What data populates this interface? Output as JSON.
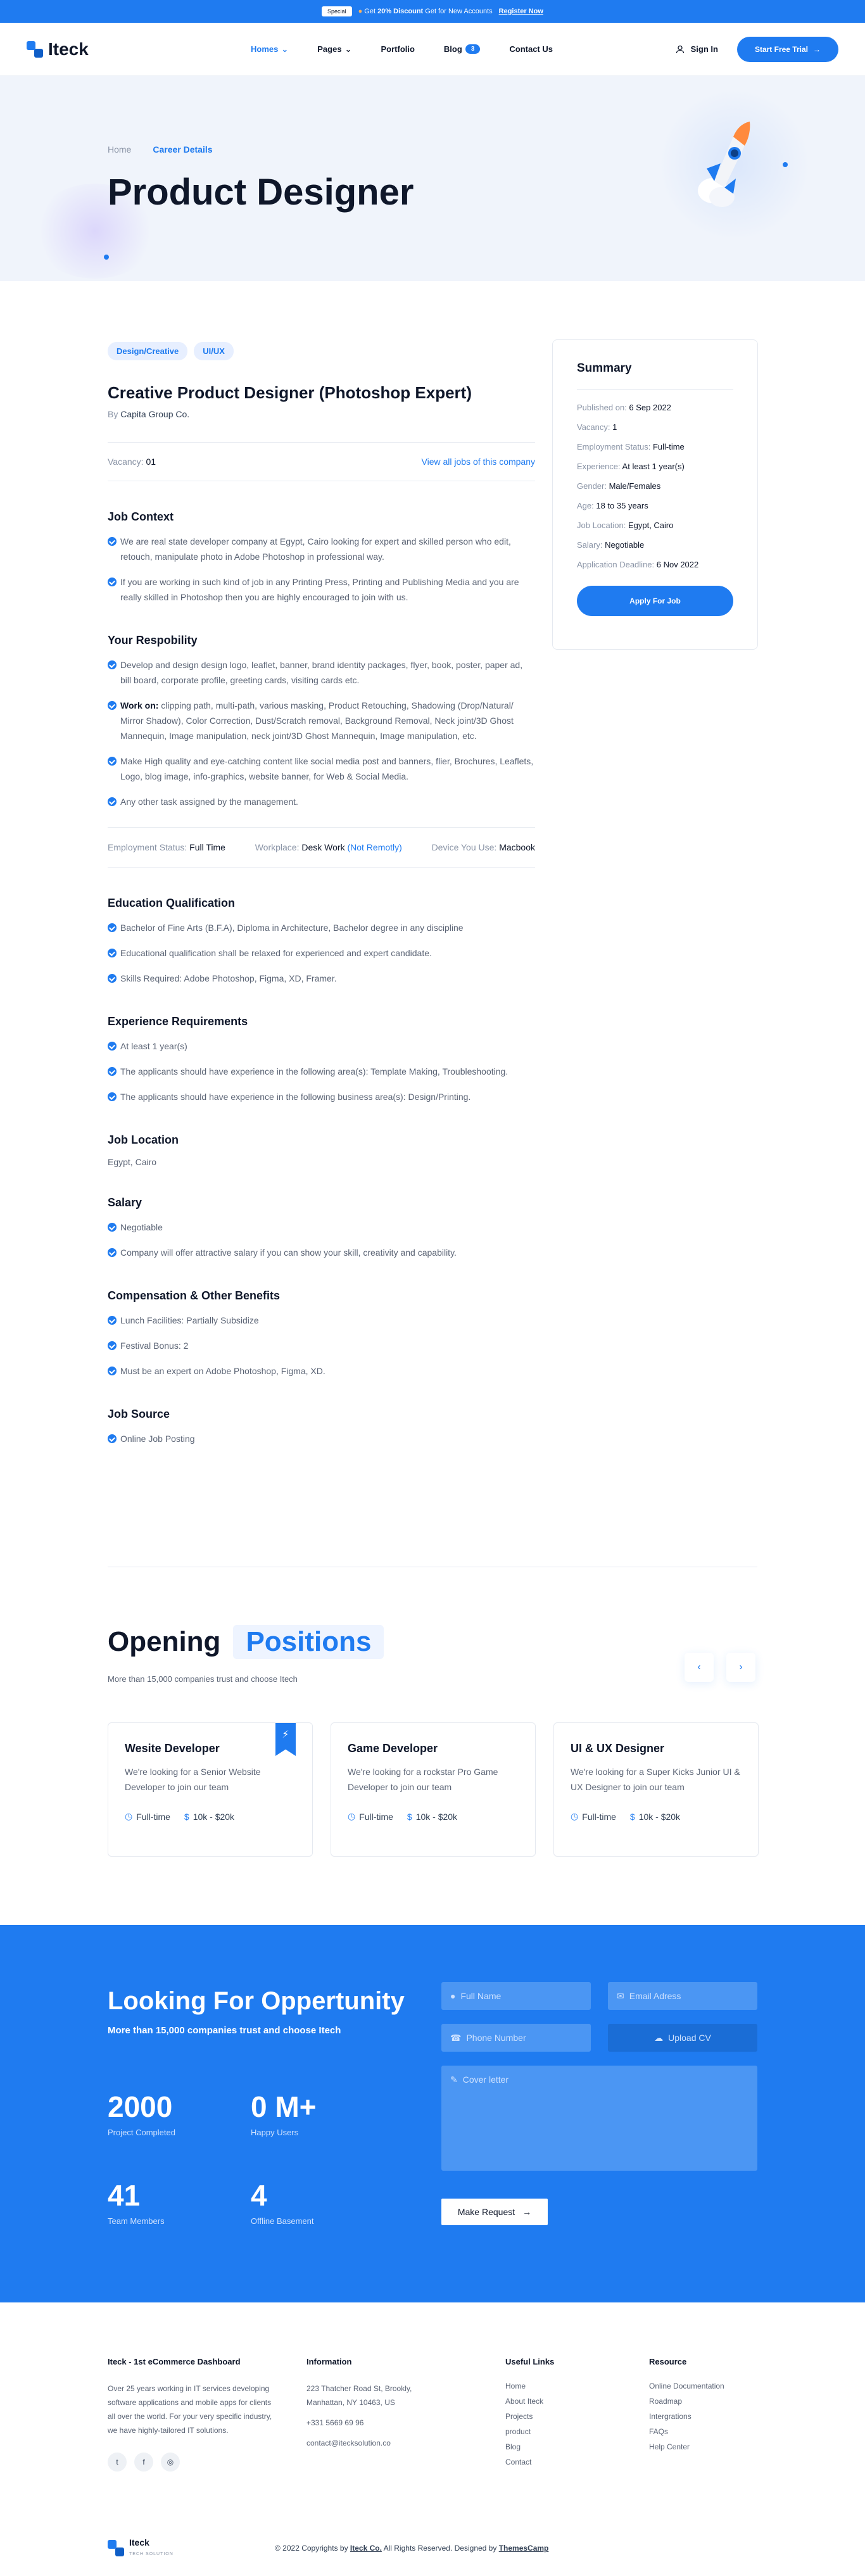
{
  "topbar": {
    "badge": "Special",
    "text_pre": "Get ",
    "discount": "20% Discount",
    "text_post": " Get for New Accounts",
    "register": "Register Now"
  },
  "header": {
    "logo": "Iteck",
    "nav": [
      {
        "label": "Homes",
        "dropdown": true,
        "active": true
      },
      {
        "label": "Pages",
        "dropdown": true,
        "active": false
      },
      {
        "label": "Portfolio",
        "dropdown": false,
        "active": false
      },
      {
        "label": "Blog",
        "dropdown": false,
        "active": false,
        "count": "3"
      },
      {
        "label": "Contact Us",
        "dropdown": false,
        "active": false
      }
    ],
    "sign_in": "Sign In",
    "cta": "Start Free Trial"
  },
  "hero": {
    "crumb_home": "Home",
    "crumb_current": "Career Details",
    "title": "Product Designer"
  },
  "job": {
    "tags": [
      "Design/Creative",
      "UI/UX"
    ],
    "title": "Creative Product Designer (Photoshop Expert)",
    "by_label": "By ",
    "company": "Capita Group Co.",
    "vacancy_label": "Vacancy: ",
    "vacancy": "01",
    "view_all": "View all jobs of this company",
    "context_title": "Job Context",
    "context": [
      "We are real state developer company at Egypt, Cairo looking for expert and skilled person who edit, retouch, manipulate photo in Adobe Photoshop in professional way.",
      "If you are working in such kind of job in any Printing Press, Printing and Publishing Media and you are really skilled in Photoshop then you are highly encouraged to join with us."
    ],
    "resp_title": "Your Respobility",
    "resp": [
      {
        "bold": "",
        "text": "Develop and design design logo, leaflet, banner, brand identity packages, flyer, book, poster, paper ad, bill board, corporate profile, greeting cards, visiting cards etc."
      },
      {
        "bold": "Work on: ",
        "text": "clipping path, multi-path, various masking, Product Retouching, Shadowing (Drop/Natural/ Mirror Shadow), Color Correction, Dust/Scratch removal, Background Removal, Neck joint/3D Ghost Mannequin, Image manipulation, neck joint/3D Ghost Mannequin, Image manipulation, etc."
      },
      {
        "bold": "",
        "text": "Make High quality and eye-catching content like social media post and banners, flier, Brochures, Leaflets, Logo, blog image, info-graphics, website banner, for Web & Social Media."
      },
      {
        "bold": "",
        "text": "Any other task assigned by the management."
      }
    ],
    "meta": {
      "employment_label": "Employment Status: ",
      "employment": "Full Time",
      "workplace_label": "Workplace: ",
      "workplace": "Desk Work",
      "workplace_note": "(Not Remotly)",
      "device_label": "Device You Use: ",
      "device": "Macbook"
    },
    "edu_title": "Education Qualification",
    "edu": [
      "Bachelor of Fine Arts (B.F.A), Diploma in Architecture, Bachelor degree in any discipline",
      "Educational qualification shall be relaxed for experienced and expert candidate.",
      "Skills Required: Adobe Photoshop, Figma, XD, Framer."
    ],
    "exp_title": "Experience Requirements",
    "exp": [
      "At least 1 year(s)",
      "The applicants should have experience in the following area(s): Template Making, Troubleshooting.",
      "The applicants should have experience in the following business area(s): Design/Printing."
    ],
    "loc_title": "Job Location",
    "location": "Egypt, Cairo",
    "salary_title": "Salary",
    "salary": [
      "Negotiable",
      "Company will offer attractive salary if you can show your skill, creativity and capability."
    ],
    "benefits_title": "Compensation & Other Benefits",
    "benefits": [
      "Lunch Facilities: Partially Subsidize",
      "Festival Bonus: 2",
      "Must be an expert on Adobe Photoshop, Figma, XD."
    ],
    "source_title": "Job Source",
    "source": [
      "Online Job Posting"
    ]
  },
  "summary": {
    "title": "Summary",
    "rows": [
      {
        "label": "Published on: ",
        "value": "6 Sep 2022"
      },
      {
        "label": "Vacancy: ",
        "value": "1"
      },
      {
        "label": "Employment Status: ",
        "value": "Full-time"
      },
      {
        "label": "Experience: ",
        "value": "At least 1 year(s)"
      },
      {
        "label": "Gender: ",
        "value": "Male/Females"
      },
      {
        "label": "Age: ",
        "value": "18 to 35 years"
      },
      {
        "label": "Job Location: ",
        "value": "Egypt, Cairo"
      },
      {
        "label": "Salary: ",
        "value": "Negotiable"
      },
      {
        "label": "Application Deadline: ",
        "value": "6 Nov 2022"
      }
    ],
    "apply": "Apply For Job"
  },
  "positions": {
    "title_a": "Opening",
    "title_b": "Positions",
    "subtitle": "More than 15,000 companies trust and choose Itech",
    "cards": [
      {
        "title": "Wesite Developer",
        "desc": "We're looking for a Senior Website Developer to join our team",
        "type": "Full-time",
        "salary": "10k - $20k",
        "featured": true
      },
      {
        "title": "Game Developer",
        "desc": "We're looking for a rockstar Pro Game Developer to join our team",
        "type": "Full-time",
        "salary": "10k - $20k",
        "featured": false
      },
      {
        "title": "UI & UX Designer",
        "desc": "We're looking for a Super Kicks Junior UI & UX Designer to join our team",
        "type": "Full-time",
        "salary": "10k - $20k",
        "featured": false
      }
    ]
  },
  "opportunity": {
    "title": "Looking For Oppertunity",
    "subtitle": "More than 15,000 companies trust and choose Itech",
    "stats": [
      {
        "value": "2000",
        "label": "Project Completed"
      },
      {
        "value": "0 M+",
        "label": "Happy Users"
      },
      {
        "value": "41",
        "label": "Team Members"
      },
      {
        "value": "4",
        "label": "Offline Basement"
      }
    ],
    "form": {
      "full_name": "Full Name",
      "email": "Email Adress",
      "phone": "Phone Number",
      "upload": "Upload CV",
      "cover": "Cover letter",
      "submit": "Make Request"
    }
  },
  "footer": {
    "about_title": "Iteck - 1st eCommerce Dashboard",
    "about_text": "Over 25 years working in IT services developing software applications and mobile apps for clients all over the world. For your very specific industry, we have highly-tailored IT solutions.",
    "info_title": "Information",
    "info_lines": [
      "223 Thatcher Road St, Brookly, Manhattan, NY 10463, US",
      "+331 5669 69 96",
      "contact@itecksolution.co"
    ],
    "links_title": "Useful Links",
    "links": [
      "Home",
      "About Iteck",
      "Projects",
      "product",
      "Blog",
      "Contact"
    ],
    "resource_title": "Resource",
    "resources": [
      "Online Documentation",
      "Roadmap",
      "Intergrations",
      "FAQs",
      "Help Center"
    ],
    "logo_name": "Iteck",
    "logo_tag": "TECH SOLUTION",
    "copy_pre": "© 2022 Copyrights by ",
    "copy_brand": "Iteck Co.",
    "copy_mid": " All Rights Reserved. Designed by ",
    "copy_designer": "ThemesCamp"
  },
  "colors": {
    "accent": "#1f7bf0",
    "text": "#0f172a",
    "muted": "#5b6475",
    "hero_bg": "#f0f4fb"
  }
}
